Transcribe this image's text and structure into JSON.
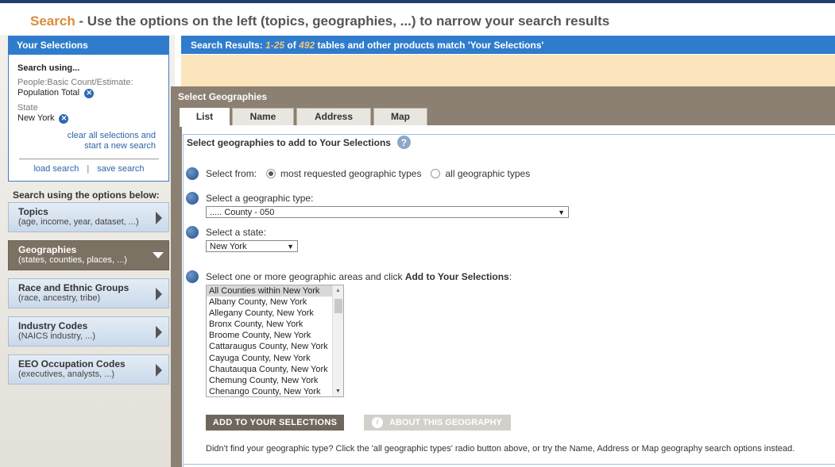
{
  "header": {
    "accent": "Search",
    "rest": " - Use the options on the left (topics, geographies, ...) to narrow your search results"
  },
  "selections": {
    "title": "Your Selections",
    "search_using": "Search using...",
    "items": [
      {
        "category": "People:Basic Count/Estimate:",
        "value": "Population Total"
      },
      {
        "category": "State",
        "value": "New York"
      }
    ],
    "clear_line1": "clear all selections and",
    "clear_line2": "start a new search",
    "load": "load search",
    "separator": "|",
    "save": "save search"
  },
  "options_label": "Search using the options below:",
  "options": [
    {
      "title": "Topics",
      "subtitle": "(age, income, year, dataset, ...)"
    },
    {
      "title": "Geographies",
      "subtitle": "(states, counties, places, ...)"
    },
    {
      "title": "Race and Ethnic Groups",
      "subtitle": "(race, ancestry, tribe)"
    },
    {
      "title": "Industry Codes",
      "subtitle": "(NAICS industry, ...)"
    },
    {
      "title": "EEO Occupation Codes",
      "subtitle": "(executives, analysts, ...)"
    }
  ],
  "results": {
    "label": "Search Results:",
    "range": "1-25",
    "of": "of",
    "total": "492",
    "suffix": "tables and other products match 'Your Selections'"
  },
  "geo": {
    "title": "Select Geographies",
    "tabs": [
      "List",
      "Name",
      "Address",
      "Map"
    ],
    "heading": "Select geographies to add to Your Selections",
    "select_from_label": "Select from:",
    "radio_most": "most requested geographic types",
    "radio_all": "all geographic types",
    "geo_type_label": "Select a geographic type:",
    "geo_type_value": "..... County - 050",
    "state_label": "Select a state:",
    "state_value": "New York",
    "areas_label_prefix": "Select one or more geographic areas and click ",
    "areas_label_bold": "Add to Your Selections",
    "areas_label_suffix": ":",
    "areas": [
      "All Counties within New York",
      "Albany County, New York",
      "Allegany County, New York",
      "Bronx County, New York",
      "Broome County, New York",
      "Cattaraugus County, New York",
      "Cayuga County, New York",
      "Chautauqua County, New York",
      "Chemung County, New York",
      "Chenango County, New York"
    ],
    "add_button": "ADD TO YOUR SELECTIONS",
    "about_button": "ABOUT THIS GEOGRAPHY",
    "footnote": "Didn't find your geographic type? Click the 'all geographic types' radio button above, or try the Name, Address or Map geography search options instead."
  },
  "icons": {
    "remove": "x-circle-icon",
    "help": "question-circle-icon",
    "info": "info-icon",
    "arrow": "chevron-right-icon"
  }
}
